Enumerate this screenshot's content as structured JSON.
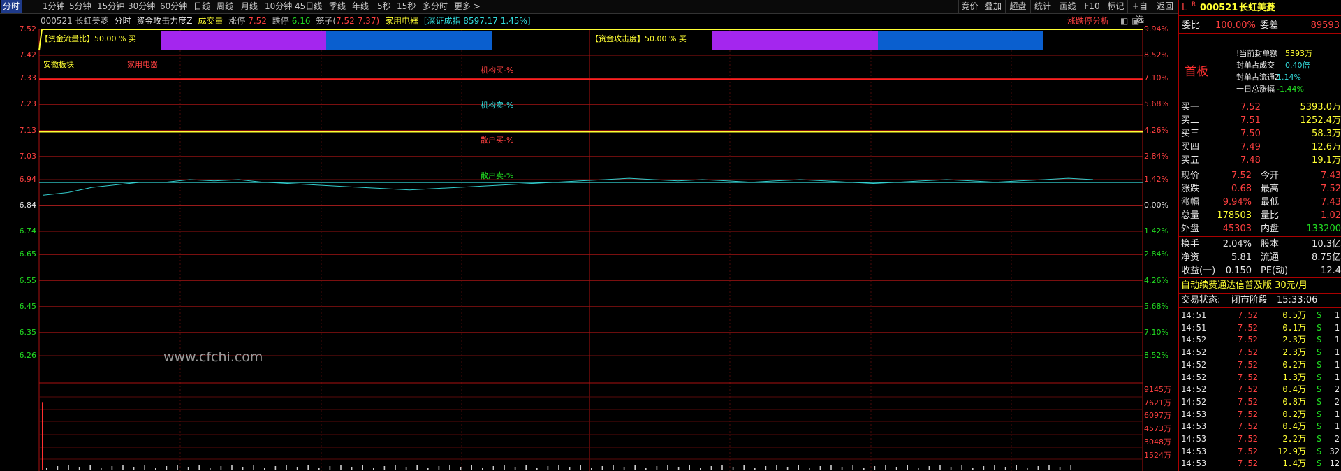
{
  "toolbar": {
    "tabs": [
      "分时",
      "1分钟",
      "5分钟",
      "15分钟",
      "30分钟",
      "60分钟",
      "日线",
      "周线",
      "月线",
      "10分钟",
      "45日线",
      "季线",
      "年线",
      "5秒",
      "15秒",
      "多分时",
      "更多 >"
    ],
    "right_buttons": [
      "竞价",
      "叠加",
      "超盘",
      "统计",
      "画线",
      "F10",
      "标记",
      "+自选",
      "返回"
    ]
  },
  "info": {
    "code_name": "000521 长虹美菱",
    "view": "分时",
    "indicator": "资金攻击力度Z",
    "volume_label": "成交量",
    "limit_up_label": "涨停",
    "limit_up": "7.52",
    "limit_down_label": "跌停",
    "limit_down": "6.16",
    "cage_label": "笼子(",
    "cage_low": "7.52",
    "cage_high": "7.37)",
    "sector": "家用电器",
    "index": "[深证成指 8597.17 1.45%]",
    "limit_analysis": "涨跌停分析"
  },
  "chart_labels": {
    "fund_flow": "【资金流量比】50.00 % 买",
    "fund_attack": "【资金攻击度】50.00 % 买",
    "sector1": "安徽板块",
    "sector2": "家用电器",
    "inst_buy": "机构买-%",
    "inst_sell": "机构卖-%",
    "retail_buy": "散户买-%",
    "retail_sell": "散户卖-%",
    "watermark": "www.cfchi.com"
  },
  "price_axis": [
    "7.52",
    "7.42",
    "7.33",
    "7.23",
    "7.13",
    "7.03",
    "6.94",
    "6.84",
    "6.74",
    "6.65",
    "6.55",
    "6.45",
    "6.35",
    "6.26"
  ],
  "pct_axis": [
    "9.94%",
    "8.52%",
    "7.10%",
    "5.68%",
    "4.26%",
    "2.84%",
    "1.42%",
    "0.00%",
    "1.42%",
    "2.84%",
    "4.26%",
    "5.68%",
    "7.10%",
    "8.52%"
  ],
  "vol_axis": [
    "9145万",
    "7621万",
    "6097万",
    "4573万",
    "3048万",
    "1524万"
  ],
  "chart_data": {
    "type": "line",
    "price_range": [
      6.26,
      7.52
    ],
    "prev_close": 6.84,
    "avg_price_line": 6.935,
    "price_series": [
      6.88,
      6.89,
      6.91,
      6.92,
      6.93,
      6.93,
      6.94,
      6.935,
      6.94,
      6.93,
      6.925,
      6.92,
      6.915,
      6.91,
      6.905,
      6.9,
      6.905,
      6.91,
      6.915,
      6.92,
      6.925,
      6.93,
      6.935,
      6.94,
      6.945,
      6.94,
      6.935,
      6.94,
      6.935,
      6.93,
      6.935,
      6.94,
      6.935,
      6.93,
      6.925,
      6.93,
      6.935,
      6.94,
      6.935,
      6.93,
      6.935,
      6.94,
      6.945,
      6.94
    ],
    "volume_first_bar": 8500,
    "volume_range": [
      0,
      9145
    ]
  },
  "side": {
    "header_flag": "L",
    "header_r": "R",
    "code": "000521",
    "name": "长虹美菱",
    "weibi_label": "委比",
    "weibi": "100.00%",
    "weicha_label": "委差",
    "weicha": "89593",
    "shouban": "首板",
    "seal": [
      {
        "label": "!当前封单额",
        "value": "5393万"
      },
      {
        "label": "封单占成交",
        "value": "0.40倍"
      },
      {
        "label": "封单占流通Z",
        "value": "1.14%"
      },
      {
        "label": "十日总涨幅",
        "value": "-1.44%"
      }
    ],
    "bids": [
      {
        "label": "买一",
        "price": "7.52",
        "vol": "5393.0万"
      },
      {
        "label": "买二",
        "price": "7.51",
        "vol": "1252.4万"
      },
      {
        "label": "买三",
        "price": "7.50",
        "vol": "58.3万"
      },
      {
        "label": "买四",
        "price": "7.49",
        "vol": "12.6万"
      },
      {
        "label": "买五",
        "price": "7.48",
        "vol": "19.1万"
      }
    ],
    "quote": [
      {
        "l1": "现价",
        "v1": "7.52",
        "l2": "今开",
        "v2": "7.43"
      },
      {
        "l1": "涨跌",
        "v1": "0.68",
        "l2": "最高",
        "v2": "7.52"
      },
      {
        "l1": "涨幅",
        "v1": "9.94%",
        "l2": "最低",
        "v2": "7.43"
      },
      {
        "l1": "总量",
        "v1": "178503",
        "l2": "量比",
        "v2": "1.02"
      },
      {
        "l1": "外盘",
        "v1": "45303",
        "l2": "内盘",
        "v2": "133200"
      }
    ],
    "fin": [
      {
        "l1": "换手",
        "v1": "2.04%",
        "l2": "股本",
        "v2": "10.3亿"
      },
      {
        "l1": "净资",
        "v1": "5.81",
        "l2": "流通",
        "v2": "8.75亿"
      },
      {
        "l1": "收益(一)",
        "v1": "0.150",
        "l2": "PE(动)",
        "v2": "12.4"
      }
    ],
    "ad": "自动续费通达信普及版  30元/月",
    "status_label": "交易状态:",
    "status": "闭市阶段",
    "time": "15:33:06",
    "ticks": [
      {
        "t": "14:51",
        "p": "7.52",
        "v": "0.5万",
        "s": "S",
        "n": "1"
      },
      {
        "t": "14:51",
        "p": "7.52",
        "v": "0.1万",
        "s": "S",
        "n": "1"
      },
      {
        "t": "14:52",
        "p": "7.52",
        "v": "2.3万",
        "s": "S",
        "n": "1"
      },
      {
        "t": "14:52",
        "p": "7.52",
        "v": "2.3万",
        "s": "S",
        "n": "1"
      },
      {
        "t": "14:52",
        "p": "7.52",
        "v": "0.2万",
        "s": "S",
        "n": "1"
      },
      {
        "t": "14:52",
        "p": "7.52",
        "v": "1.3万",
        "s": "S",
        "n": "1"
      },
      {
        "t": "14:52",
        "p": "7.52",
        "v": "0.4万",
        "s": "S",
        "n": "2"
      },
      {
        "t": "14:52",
        "p": "7.52",
        "v": "0.8万",
        "s": "S",
        "n": "2"
      },
      {
        "t": "14:53",
        "p": "7.52",
        "v": "0.2万",
        "s": "S",
        "n": "1"
      },
      {
        "t": "14:53",
        "p": "7.52",
        "v": "0.4万",
        "s": "S",
        "n": "1"
      },
      {
        "t": "14:53",
        "p": "7.52",
        "v": "2.2万",
        "s": "S",
        "n": "2"
      },
      {
        "t": "14:53",
        "p": "7.52",
        "v": "12.9万",
        "s": "S",
        "n": "32"
      },
      {
        "t": "14:53",
        "p": "7.52",
        "v": "1.4万",
        "s": "S",
        "n": "12"
      }
    ]
  }
}
